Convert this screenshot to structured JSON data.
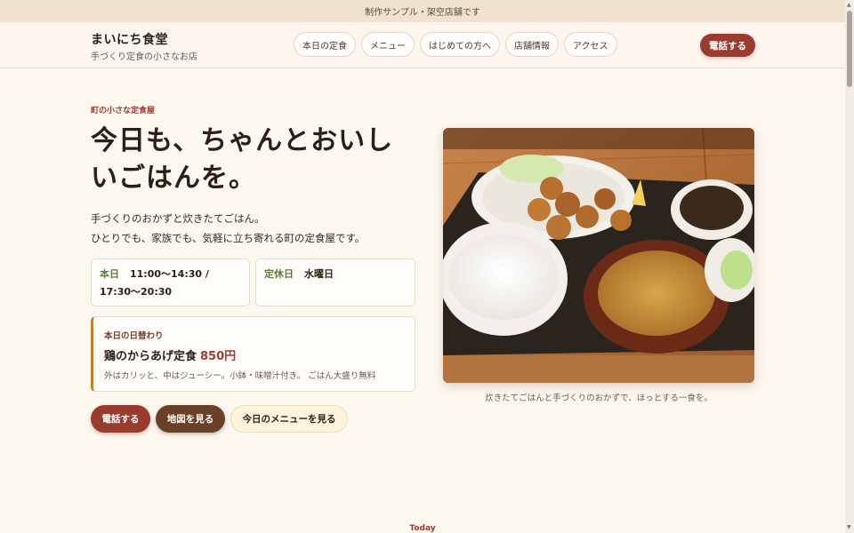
{
  "notice": "制作サンプル・架空店舗です",
  "header": {
    "brand_title": "まいにち食堂",
    "brand_sub": "手づくり定食の小さなお店",
    "nav": [
      "本日の定食",
      "メニュー",
      "はじめての方へ",
      "店舗情報",
      "アクセス"
    ],
    "call_label": "電話する"
  },
  "hero": {
    "eyebrow": "町の小さな定食屋",
    "headline_line1": "今日も、ちゃんとおいし",
    "headline_line2": "いごはんを。",
    "lead_line1": "手づくりのおかずと炊きたてごはん。",
    "lead_line2": "ひとりでも、家族でも、気軽に立ち寄れる町の定食屋です。",
    "hours_label": "本日",
    "hours_line1": "11:00〜14:30 /",
    "hours_line2": "17:30〜20:30",
    "closed_label": "定休日",
    "closed_value": "水曜日",
    "special_label": "本日の日替わり",
    "special_name": "鶏のからあげ定食",
    "special_price": "850円",
    "special_desc": "外はカリッと、中はジューシー。小鉢・味噌汁付き。 ごはん大盛り無料",
    "buttons": {
      "call": "電話する",
      "map": "地図を見る",
      "menu": "今日のメニューを見る"
    },
    "photo_caption": "炊きたてごはんと手づくりのおかずで、ほっとする一食を。"
  },
  "next_section_eyebrow": "Today",
  "colors": {
    "accent": "#9a3b30",
    "brown": "#6a4028",
    "background": "#fdf8ef",
    "green_label": "#5a7a3a"
  }
}
